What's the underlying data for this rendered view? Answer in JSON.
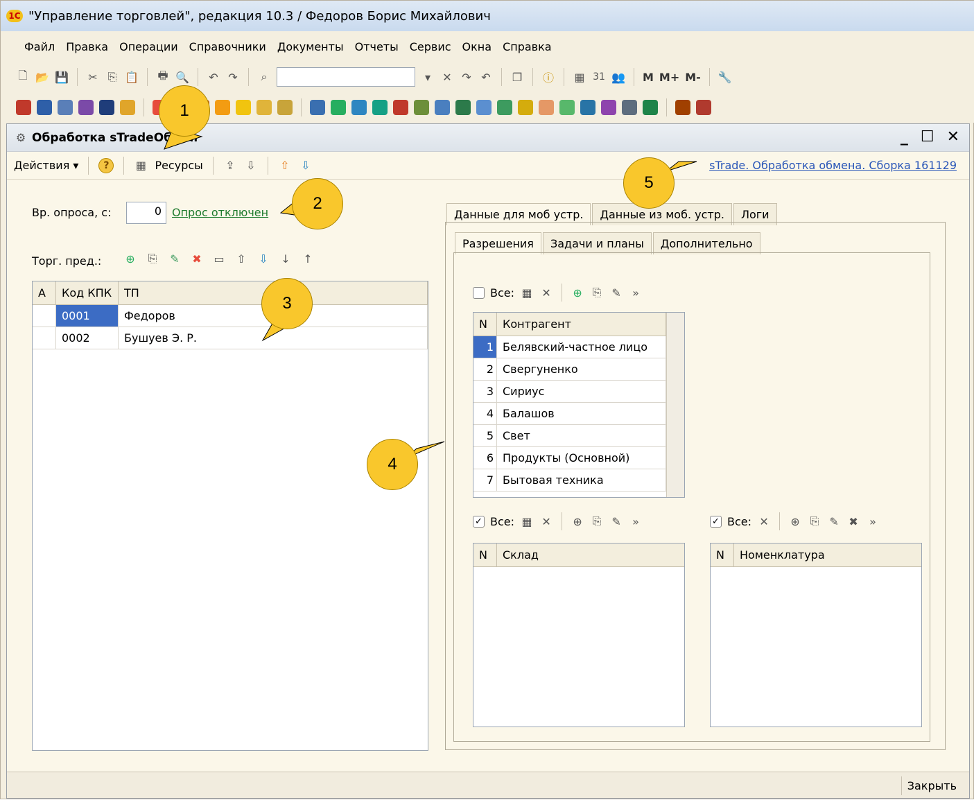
{
  "window": {
    "title": "\"Управление торговлей\", редакция 10.3 / Федоров Борис Михайлович",
    "logo": "1С"
  },
  "menu": [
    "Файл",
    "Правка",
    "Операции",
    "Справочники",
    "Документы",
    "Отчеты",
    "Сервис",
    "Окна",
    "Справка"
  ],
  "toolbar": {
    "mbtns": [
      "M",
      "M+",
      "M-"
    ],
    "calendar_label": "31"
  },
  "doc": {
    "title": "Обработка  sTradeОбмен",
    "cmd_actions": "Действия ▾",
    "cmd_resources": "Ресурсы",
    "version_link": "sTrade. Обработка обмена. Сборка 161129",
    "poll_label": "Вр. опроса, с:",
    "poll_value": "0",
    "poll_status": "Опрос отключен",
    "reps_label": "Торг. пред.:",
    "reps_table": {
      "headers": [
        "А",
        "Код КПК",
        "ТП"
      ],
      "rows": [
        [
          "",
          "0001",
          "Федоров"
        ],
        [
          "",
          "0002",
          "Бушуев Э. Р."
        ]
      ]
    },
    "tabs_main": [
      "Данные для моб устр.",
      "Данные из моб. устр.",
      "Логи"
    ],
    "tabs_sub": [
      "Разрешения",
      "Задачи и планы",
      "Дополнительно"
    ],
    "all_label": "Все:",
    "contractors": {
      "headers": [
        "N",
        "Контрагент"
      ],
      "rows": [
        [
          "1",
          "Белявский-частное лицо"
        ],
        [
          "2",
          "Свергуненко"
        ],
        [
          "3",
          "Сириус"
        ],
        [
          "4",
          "Балашов"
        ],
        [
          "5",
          "Свет"
        ],
        [
          "6",
          "Продукты (Основной)"
        ],
        [
          "7",
          "Бытовая техника"
        ]
      ]
    },
    "warehouse": {
      "headers": [
        "N",
        "Склад"
      ]
    },
    "nomenclature": {
      "headers": [
        "N",
        "Номенклатура"
      ]
    },
    "close_btn": "Закрыть"
  },
  "callouts": [
    "1",
    "2",
    "3",
    "4",
    "5"
  ],
  "colors": {
    "callout": "#f9c72c",
    "selection": "#3c6cc4",
    "link": "#2a56b8",
    "green_link": "#1e7b2e"
  }
}
